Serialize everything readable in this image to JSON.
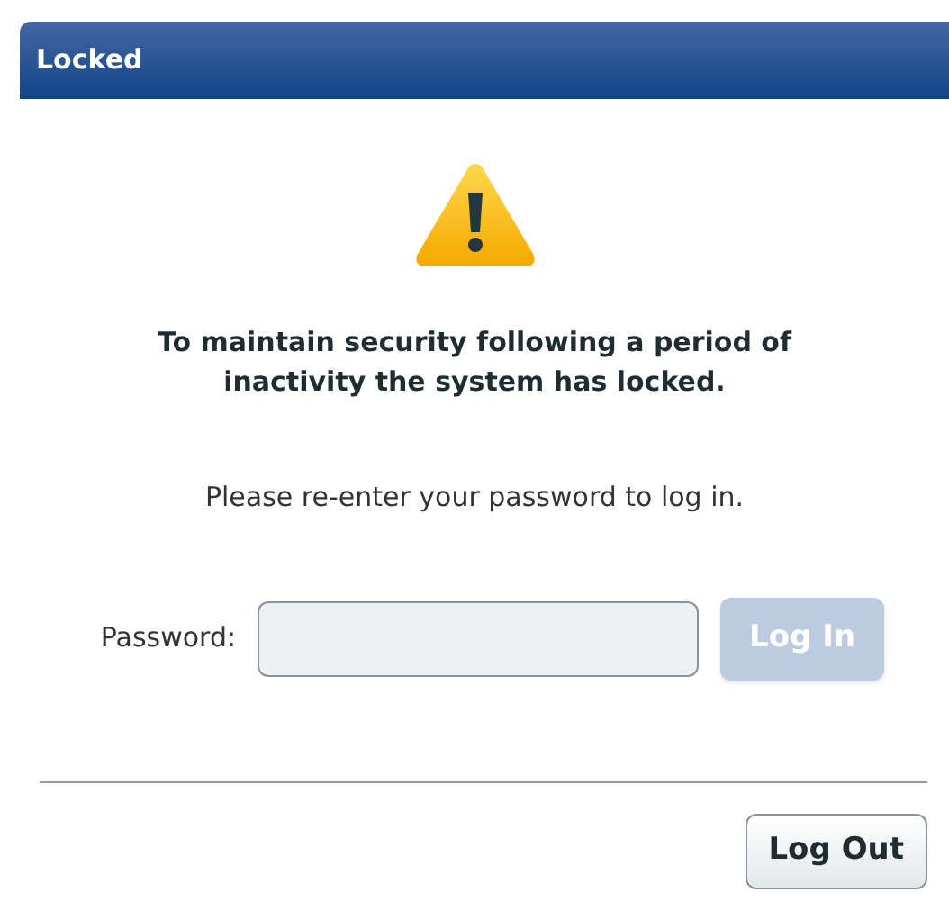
{
  "window": {
    "title": "Locked"
  },
  "message": "To maintain security following a period of inactivity the system has locked.",
  "instruction": "Please re-enter your password to log in.",
  "password": {
    "label": "Password:"
  },
  "login_button": {
    "label": "Log In",
    "disabled": true
  },
  "logout_button": {
    "label": "Log Out",
    "disabled": false
  }
}
